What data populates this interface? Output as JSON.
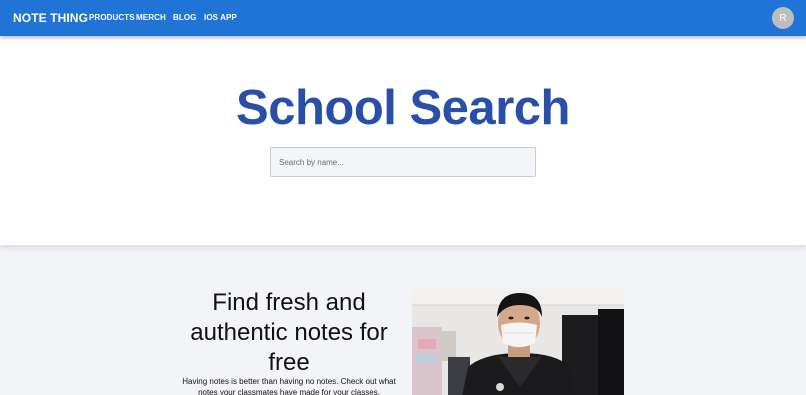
{
  "navbar": {
    "brand": "NOTE THING",
    "links": [
      "PRODUCTS",
      "MERCH",
      "BLOG",
      "IOS APP"
    ],
    "avatar_initial": "R",
    "color": "#1f74d6"
  },
  "hero": {
    "title": "School Search",
    "search_placeholder": "Search by name...",
    "title_color": "#2a4fa8"
  },
  "feature": {
    "heading": "Find fresh and authentic notes for free",
    "description": "Having notes is better than having no notes. Check out what notes your classmates have made for your classes."
  }
}
